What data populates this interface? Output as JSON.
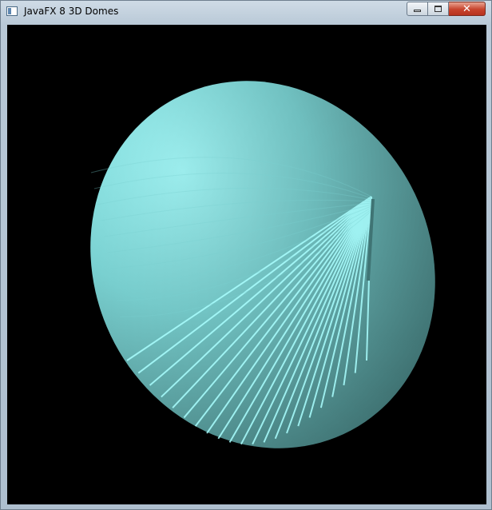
{
  "window": {
    "title": "JavaFX 8 3D Domes",
    "controls": {
      "minimize_glyph": "minimize-icon",
      "maximize_glyph": "maximize-icon",
      "close_glyph": "✕"
    }
  },
  "scene": {
    "background": "#000000",
    "dome_color": "#7fffff",
    "dome_highlight": "#a8ffff",
    "dome_shadow": "#4e8e8e"
  }
}
